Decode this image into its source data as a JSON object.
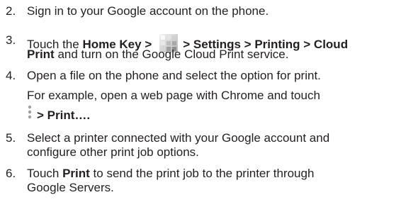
{
  "steps": [
    {
      "number": "2.",
      "lines": [
        [
          "Sign in to your Google account on the phone."
        ]
      ]
    },
    {
      "number": "3.",
      "parts": {
        "pre": "Touch the ",
        "home_key": "Home Key >",
        "settings_path": "> Settings > Printing > Cloud",
        "line2_bold": "Print",
        "line2_rest": " and turn on the Google Cloud Print service."
      },
      "icon": "apps-grid-icon"
    },
    {
      "number": "4.",
      "line1": "Open a file on the phone and select the option for print.",
      "example": "For example, open a web page with Chrome and touch",
      "menu_icon": "more-options-icon",
      "print_path": "> Print…."
    },
    {
      "number": "5.",
      "line1": "Select a printer connected with your Google account and",
      "line2": "configure other print job options."
    },
    {
      "number": "6.",
      "pre": "Touch ",
      "bold": "Print",
      "post": " to send the print job to the printer through",
      "line2": "Google Servers."
    }
  ],
  "colors": {
    "text": "#231f20",
    "icon_tile": "#c9c9c9",
    "dots": "#9a9a9a"
  }
}
